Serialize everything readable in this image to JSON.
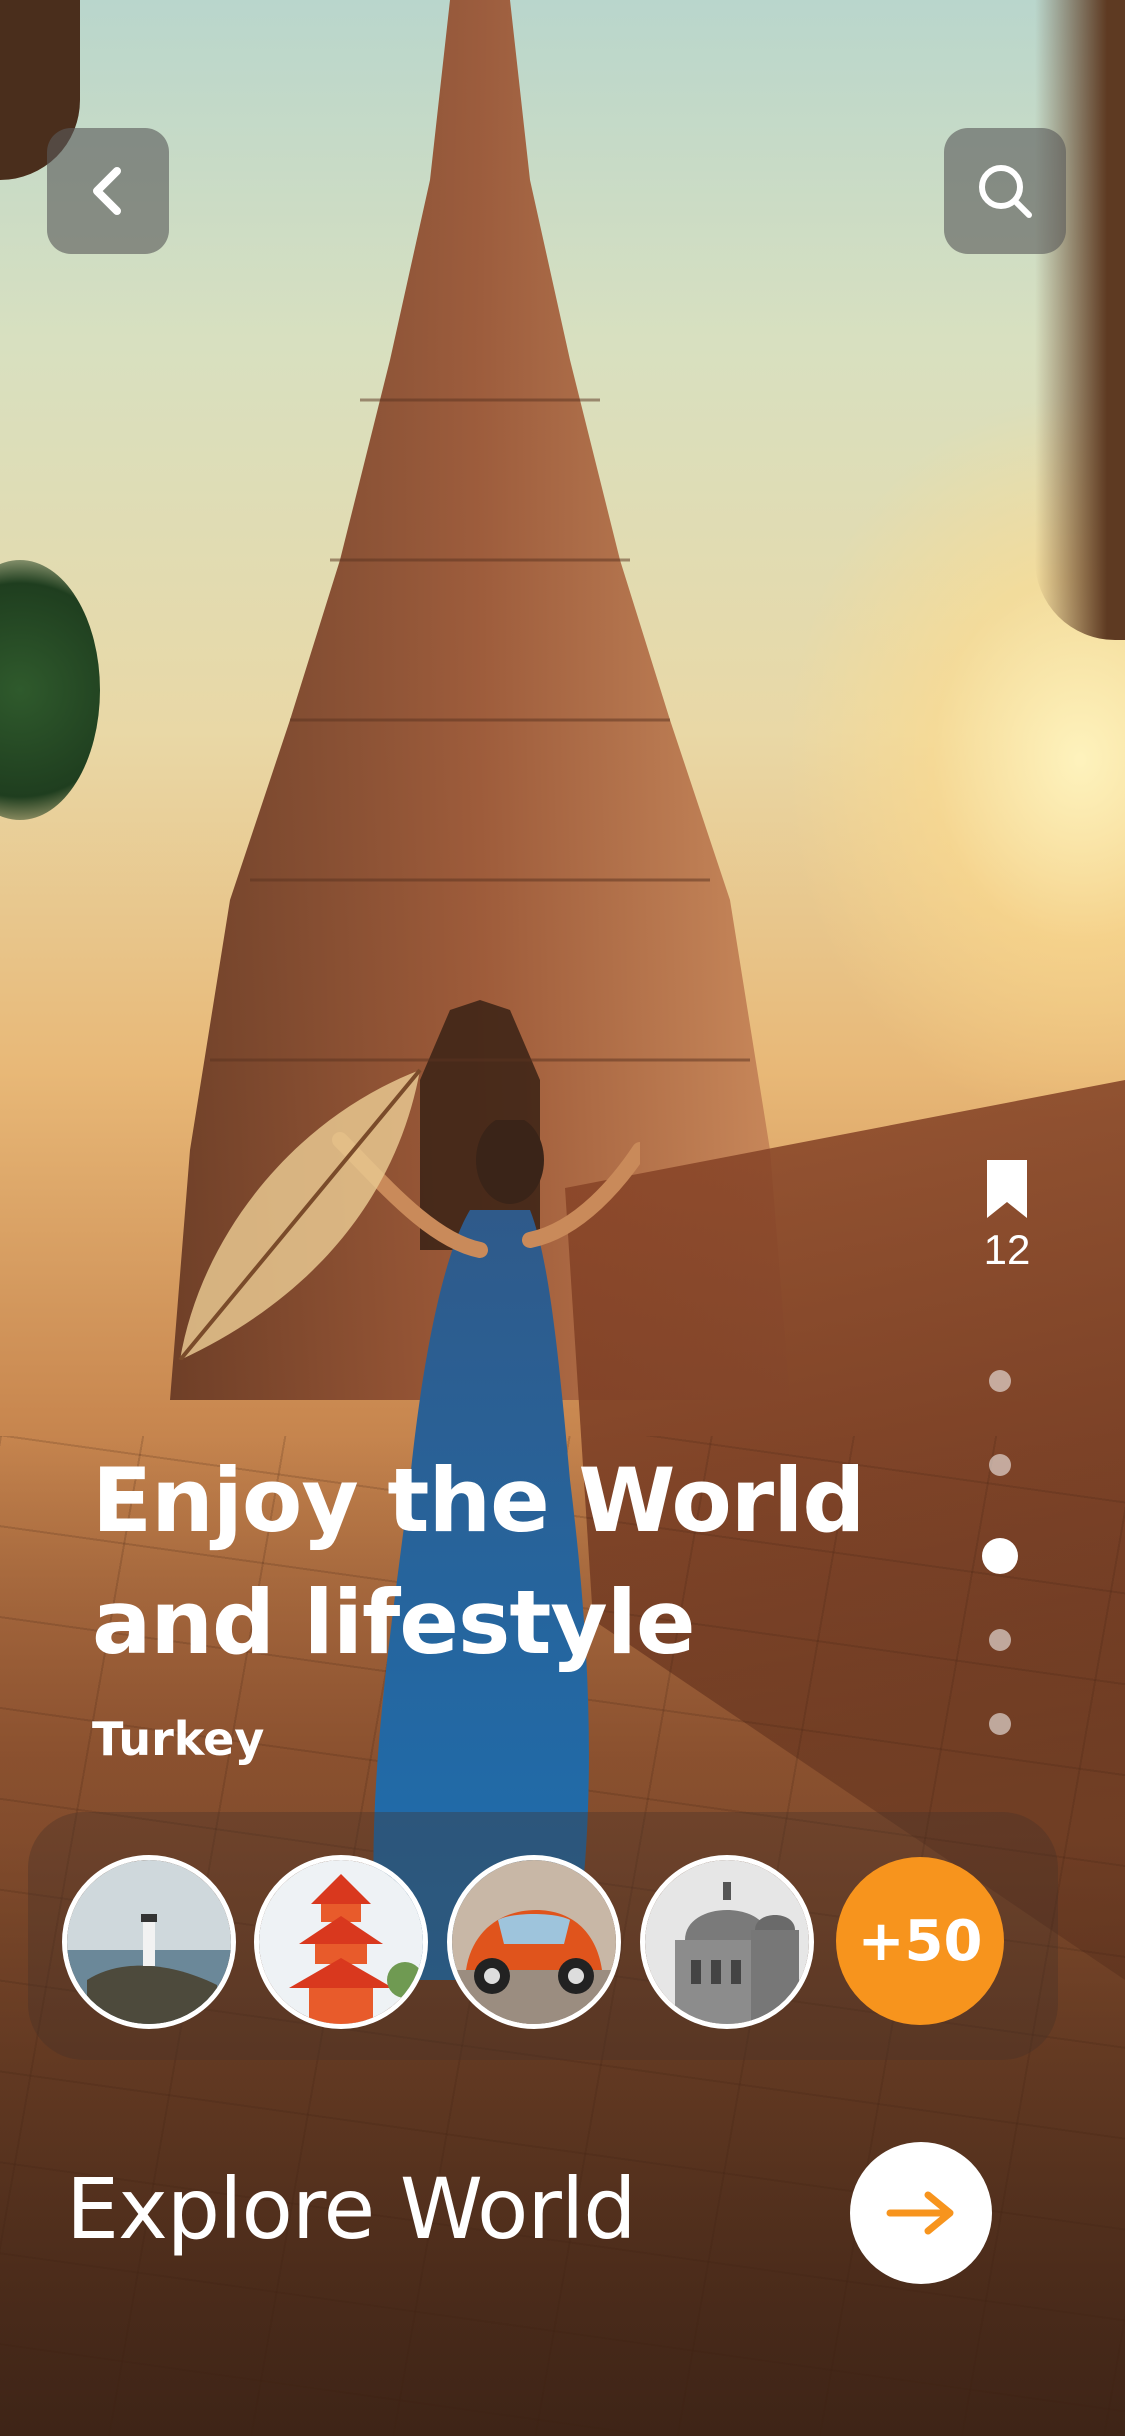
{
  "header": {
    "back_icon": "chevron-left-icon",
    "search_icon": "search-icon"
  },
  "side": {
    "bookmark_icon": "bookmark-icon",
    "bookmark_count": "12",
    "pager": {
      "total": 5,
      "active_index": 2
    }
  },
  "hero": {
    "title_line1": "Enjoy the World",
    "title_line2": "and lifestyle",
    "location": "Turkey"
  },
  "destinations": {
    "thumbnails": [
      {
        "name": "lighthouse"
      },
      {
        "name": "pagoda"
      },
      {
        "name": "orange-car"
      },
      {
        "name": "basilica"
      }
    ],
    "more_label": "+50"
  },
  "cta": {
    "label": "Explore World",
    "arrow_icon": "arrow-right-icon"
  },
  "colors": {
    "accent": "#f7941d",
    "button_overlay": "#5a5a5a"
  }
}
